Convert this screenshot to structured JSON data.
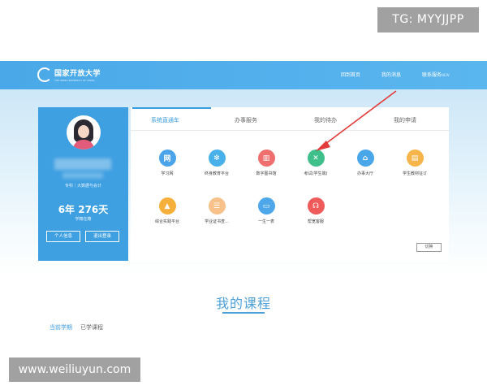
{
  "watermarks": {
    "tg": "TG: MYYJJPP",
    "url": "www.weiliuyun.com"
  },
  "header": {
    "logo_title": "国家开放大学",
    "logo_subtitle": "THE OPEN UNIVERSITY OF CHINA",
    "nav": [
      {
        "label": "回到首页"
      },
      {
        "label": "我的消息"
      },
      {
        "label": "联系服务",
        "sup": "NEW"
      }
    ]
  },
  "profile": {
    "meta": "专科｜大数据与会计",
    "duration": "6年 276天",
    "duration_label": "学籍在籍",
    "btn_personal": "个人信息",
    "btn_logout": "退出登录"
  },
  "panel": {
    "tabs": [
      {
        "label": "系统直通车",
        "active": true
      },
      {
        "label": "办事服务",
        "active": false
      },
      {
        "label": "我的待办",
        "active": false
      },
      {
        "label": "我的申请",
        "active": false
      }
    ],
    "apps": [
      {
        "label": "学习网",
        "icon": "book-icon",
        "glyph": "网",
        "color": "#4ba4ea"
      },
      {
        "label": "终身教育平台",
        "icon": "snowflake-icon",
        "glyph": "✻",
        "color": "#49b1ea"
      },
      {
        "label": "数字图书馆",
        "icon": "library-icon",
        "glyph": "▥",
        "color": "#ef6f6f"
      },
      {
        "label": "考试(学生端)",
        "icon": "exam-icon",
        "glyph": "✕",
        "color": "#3fbf8a"
      },
      {
        "label": "办事大厅",
        "icon": "hall-icon",
        "glyph": "⌂",
        "color": "#49a6e9"
      },
      {
        "label": "学生教材征订",
        "icon": "textbook-icon",
        "glyph": "▤",
        "color": "#f5b54a"
      },
      {
        "label": "综合实践平台",
        "icon": "graduation-cap-icon",
        "glyph": "▲",
        "color": "#f5b03c"
      },
      {
        "label": "学业证书查...",
        "icon": "certificate-icon",
        "glyph": "☰",
        "color": "#f8c18a"
      },
      {
        "label": "一生一表",
        "icon": "form-icon",
        "glyph": "▭",
        "color": "#4ea7ea"
      },
      {
        "label": "帮宽客服",
        "icon": "headset-icon",
        "glyph": "☊",
        "color": "#ef5a5a"
      }
    ],
    "switch_label": "切换"
  },
  "courses": {
    "title": "我的课程",
    "tabs": [
      "当前学期",
      "已学课程"
    ]
  }
}
